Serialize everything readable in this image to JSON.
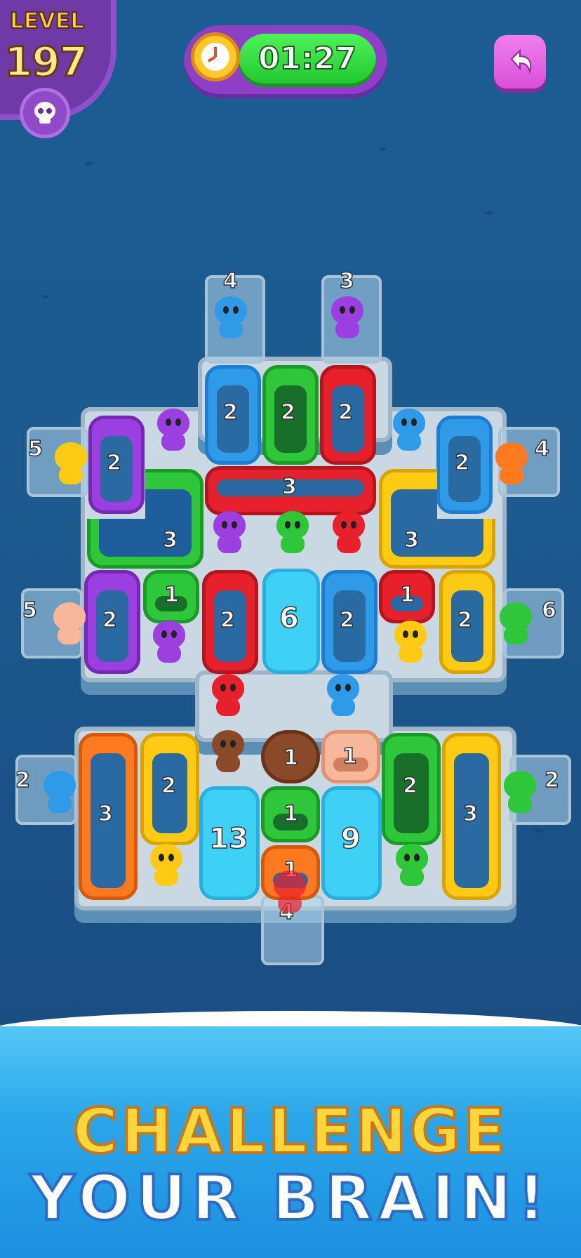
{
  "hud": {
    "level_label": "LEVEL",
    "level_number": "197",
    "timer": "01:27",
    "icons": [
      "skull-icon",
      "stopwatch-icon",
      "undo-icon"
    ]
  },
  "board": {
    "gates_top": [
      "4",
      "3"
    ],
    "gates_left": [
      "5",
      "5",
      "2"
    ],
    "gates_right": [
      "4",
      "6",
      "2"
    ],
    "gate_bottom": "4",
    "slots": [
      "2",
      "2",
      "2",
      "2",
      "3",
      "2",
      "3",
      "3",
      "1",
      "2",
      "6",
      "2",
      "1",
      "2",
      "2",
      "1",
      "1",
      "3",
      "2",
      "13",
      "1",
      "9",
      "2",
      "3",
      "1"
    ]
  },
  "banner": {
    "line1": "CHALLENGE",
    "line2": "YOUR BRAIN!"
  },
  "colors": {
    "purple": "#9b3fe0",
    "green": "#2ec73a",
    "red": "#e8202c",
    "blue": "#2f9be8",
    "cyan": "#3fd0f5",
    "yellow": "#ffcb12",
    "orange": "#ff7a1f",
    "peach": "#f6b79a",
    "brown": "#8a4a2a"
  }
}
